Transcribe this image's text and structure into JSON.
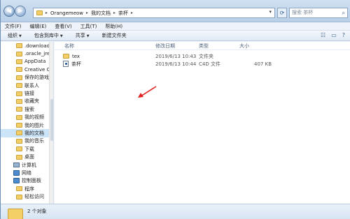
{
  "address": {
    "crumbs": [
      "Orangemeow",
      "我的文档",
      "茶杯"
    ],
    "search_placeholder": "搜索 茶杯"
  },
  "menu": [
    "文件(F)",
    "编辑(E)",
    "查看(V)",
    "工具(T)",
    "帮助(H)"
  ],
  "toolbar": {
    "organize": "组织",
    "include": "包含到库中",
    "share": "共享",
    "new_folder": "新建文件夹"
  },
  "sidebar": [
    {
      "label": ".downloader",
      "icon": "folder-icon"
    },
    {
      "label": ".oracle_jre_us",
      "icon": "folder-icon"
    },
    {
      "label": "AppData",
      "icon": "folder-icon"
    },
    {
      "label": "Creative Clou",
      "icon": "folder-icon"
    },
    {
      "label": "保存的游戏",
      "icon": "folder-icon"
    },
    {
      "label": "联系人",
      "icon": "folder-icon"
    },
    {
      "label": "链接",
      "icon": "folder-icon"
    },
    {
      "label": "收藏夹",
      "icon": "folder-icon"
    },
    {
      "label": "搜索",
      "icon": "folder-icon"
    },
    {
      "label": "我的视频",
      "icon": "folder-icon"
    },
    {
      "label": "我的图片",
      "icon": "folder-icon"
    },
    {
      "label": "我的文档",
      "icon": "folder-icon",
      "selected": true
    },
    {
      "label": "我的音乐",
      "icon": "folder-icon"
    },
    {
      "label": "下载",
      "icon": "folder-icon"
    },
    {
      "label": "桌面",
      "icon": "folder-icon"
    },
    {
      "label": "计算机",
      "icon": "computer-icon",
      "top": true
    },
    {
      "label": "网络",
      "icon": "network-icon",
      "top": true
    },
    {
      "label": "控制面板",
      "icon": "control-panel-icon",
      "top": true
    },
    {
      "label": "程序",
      "icon": "folder-icon"
    },
    {
      "label": "轻松访问",
      "icon": "folder-icon"
    }
  ],
  "columns": {
    "name": "名称",
    "date": "修改日期",
    "type": "类型",
    "size": "大小"
  },
  "files": [
    {
      "name": "tex",
      "date": "2019/6/13 10:43",
      "type": "文件夹",
      "size": "",
      "icon": "folder-icon"
    },
    {
      "name": "茶杯",
      "date": "2019/6/13 10:44",
      "type": "C4D 文件",
      "size": "407 KB",
      "icon": "c4d-file-icon"
    }
  ],
  "status": {
    "count": "2 个对象"
  }
}
